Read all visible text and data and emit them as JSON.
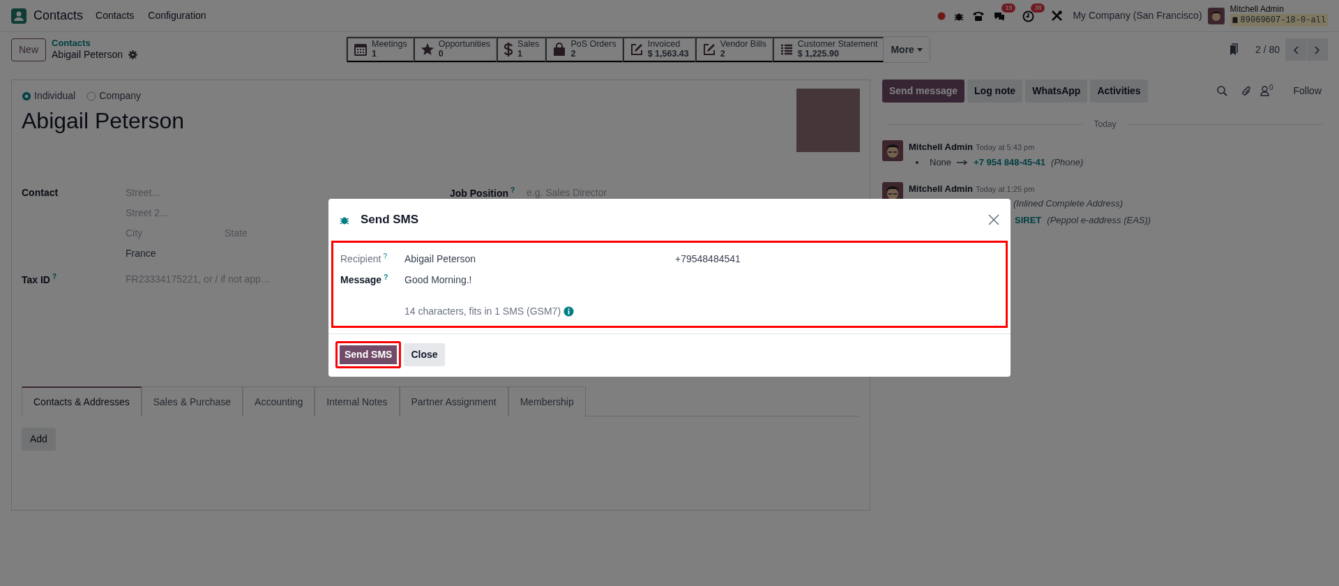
{
  "navbar": {
    "app_name": "Contacts",
    "menu": [
      {
        "label": "Contacts"
      },
      {
        "label": "Configuration"
      }
    ],
    "systray": {
      "messages_badge": "18",
      "activities_badge": "38",
      "company": "My Company (San Francisco)",
      "user_name": "Mitchell Admin",
      "database": "89069607-18-0-all"
    }
  },
  "control_panel": {
    "new_button": "New",
    "breadcrumb": {
      "parent": "Contacts",
      "current": "Abigail Peterson"
    },
    "smart_buttons": [
      {
        "kind": "calendar",
        "label": "Meetings",
        "value": "1"
      },
      {
        "kind": "star",
        "label": "Opportunities",
        "value": "0"
      },
      {
        "kind": "dollar",
        "label": "Sales",
        "value": "1"
      },
      {
        "kind": "bag",
        "label": "PoS Orders",
        "value": "2"
      },
      {
        "kind": "edit",
        "label": "Invoiced",
        "value": "$ 1,563.43"
      },
      {
        "kind": "edit",
        "label": "Vendor Bills",
        "value": "2"
      },
      {
        "kind": "list",
        "label": "Customer Statement",
        "value": "$ 1,225.90"
      }
    ],
    "more_button": "More",
    "pager": "2 / 80"
  },
  "form": {
    "company_type": [
      {
        "label": "Individual",
        "selected": true
      },
      {
        "label": "Company",
        "selected": false
      }
    ],
    "name": "Abigail Peterson",
    "contact_label": "Contact",
    "address": {
      "street": "Street...",
      "street2": "Street 2...",
      "city": "City",
      "state": "State",
      "country": "France"
    },
    "tax_id": {
      "label": "Tax ID",
      "help": "?",
      "placeholder": "FR23334175221, or / if not app…"
    },
    "job_position": {
      "label": "Job Position",
      "help": "?",
      "placeholder": "e.g. Sales Director"
    },
    "tabs": [
      {
        "label": "Contacts & Addresses",
        "selected": true
      },
      {
        "label": "Sales & Purchase",
        "selected": false
      },
      {
        "label": "Accounting",
        "selected": false
      },
      {
        "label": "Internal Notes",
        "selected": false
      },
      {
        "label": "Partner Assignment",
        "selected": false
      },
      {
        "label": "Membership",
        "selected": false
      }
    ],
    "add_button": "Add"
  },
  "chatter": {
    "buttons": [
      {
        "label": "Send message",
        "kind": "primary"
      },
      {
        "label": "Log note",
        "kind": "secondary"
      },
      {
        "label": "WhatsApp",
        "kind": "secondary"
      },
      {
        "label": "Activities",
        "kind": "secondary"
      }
    ],
    "followers_count": "0",
    "follow": "Follow",
    "divider": "Today",
    "messages": [
      {
        "author": "Mitchell Admin",
        "time": "Today at 5:43 pm",
        "changes": [
          {
            "old": "None",
            "new": "+7 954 848-45-41",
            "field": "(Phone)"
          }
        ]
      },
      {
        "author": "Mitchell Admin",
        "time": "Today at 1:25 pm",
        "changes": [
          {
            "field": "(Inlined Complete Address)"
          },
          {
            "new": "SIRET",
            "field": "(Peppol e-address (EAS))"
          }
        ]
      }
    ]
  },
  "dialog": {
    "title": "Send SMS",
    "highlighted": true,
    "recipient": {
      "label": "Recipient",
      "help": "?",
      "name": "Abigail Peterson",
      "phone": "+79548484541"
    },
    "message": {
      "label": "Message",
      "help": "?",
      "value": "Good Morning.!",
      "count": "14 characters, fits in 1 SMS (GSM7)"
    },
    "buttons": [
      {
        "label": "Send SMS",
        "kind": "primary",
        "highlighted": true
      },
      {
        "label": "Close",
        "kind": "secondary",
        "highlighted": false
      }
    ]
  }
}
